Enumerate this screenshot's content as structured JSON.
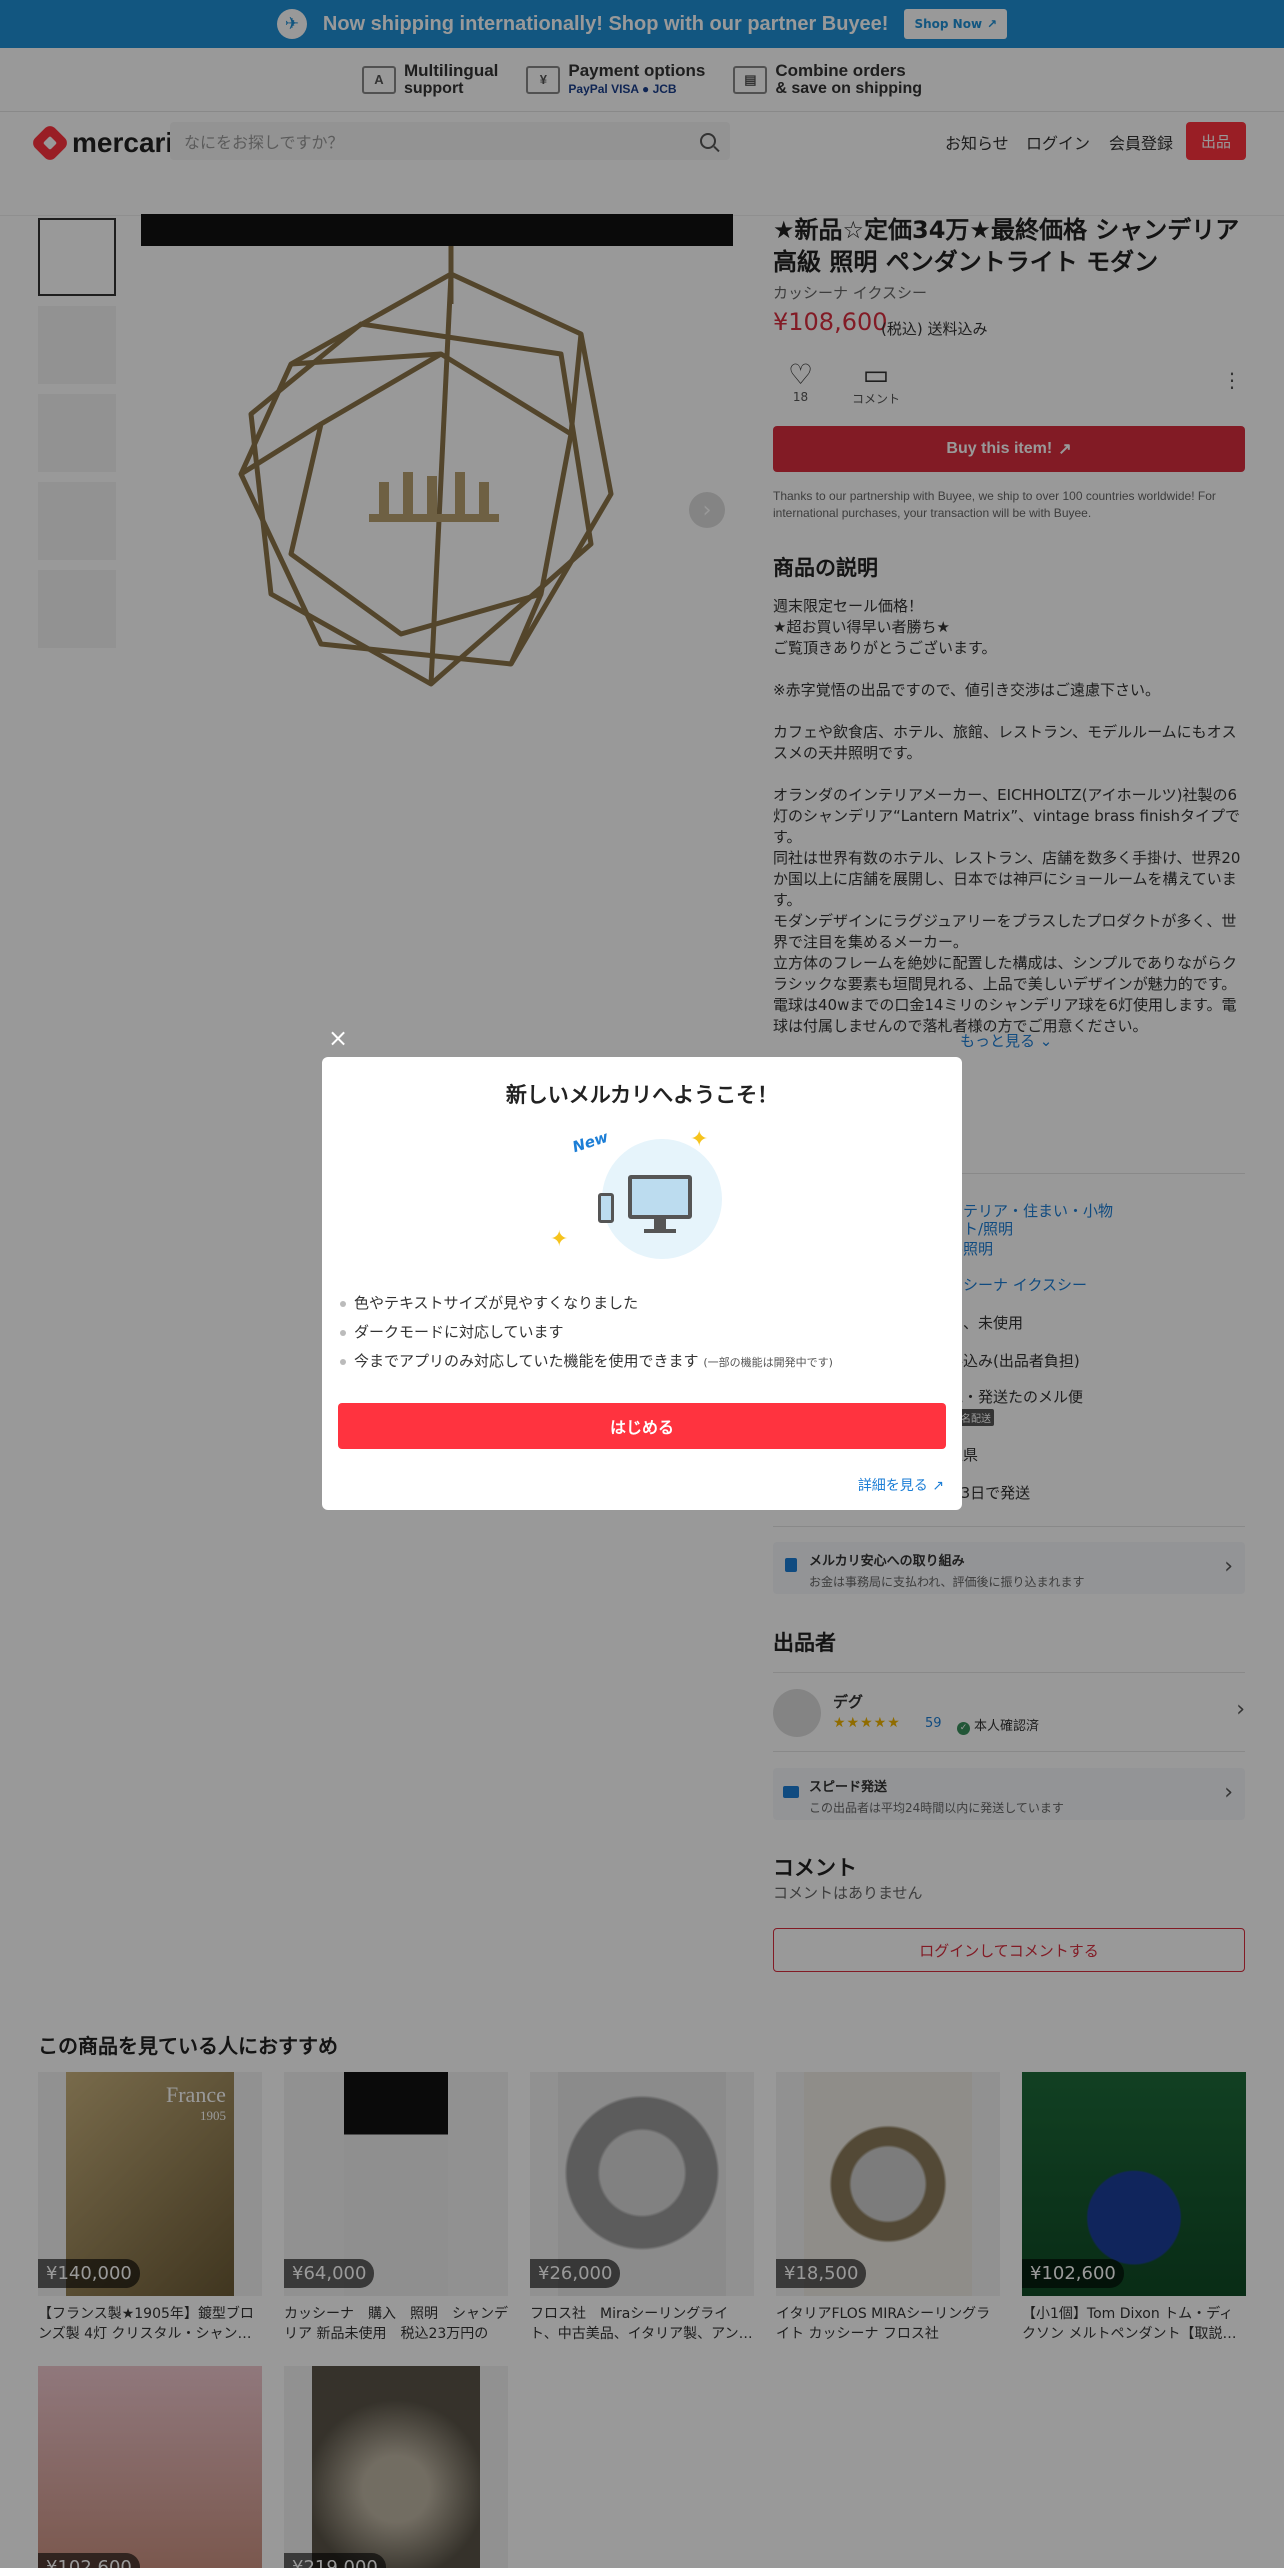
{
  "banner": {
    "text": "Now shipping internationally! Shop with our partner Buyee!",
    "button": "Shop Now"
  },
  "features": [
    {
      "icon": "A",
      "line1": "Multilingual",
      "line2": "support"
    },
    {
      "icon": "¥",
      "line1": "Payment options",
      "line2": "PayPal VISA ● JCB"
    },
    {
      "icon": "▤",
      "line1": "Combine orders",
      "line2": "& save on shipping"
    }
  ],
  "header": {
    "logo": "mercari",
    "search_placeholder": "なにをお探しですか？",
    "nav": {
      "notice": "お知らせ",
      "login": "ログイン",
      "signup": "会員登録",
      "sell": "出品"
    }
  },
  "item": {
    "title": "★新品☆定価34万★最終価格 シャンデリア 高級 照明 ペンダントライト モダン",
    "brand": "カッシーナ イクスシー",
    "price": "¥108,600",
    "price_note": "(税込) 送料込み",
    "likes": "18",
    "comment_label": "コメント",
    "buy_button": "Buy this item!",
    "buy_note": "Thanks to our partnership with Buyee, we ship to over 100 countries worldwide! For international purchases, your transaction will be with Buyee.",
    "desc_title": "商品の説明",
    "description": "週末限定セール価格！\n★超お買い得早い者勝ち★\nご覧頂きありがとうございます。\n\n※赤字覚悟の出品ですので、値引き交渉はご遠慮下さい。\n\nカフェや飲食店、ホテル、旅館、レストラン、モデルルームにもオススメの天井照明です。\n\nオランダのインテリアメーカー、EICHHOLTZ(アイホールツ)社製の6灯のシャンデリア“Lantern Matrix”、vintage brass finishタイプです。\n同社は世界有数のホテル、レストラン、店舗を数多く手掛け、世界20か国以上に店舗を展開し、日本では神戸にショールームを構えています。\nモダンデザインにラグジュアリーをプラスしたプロダクトが多く、世界で注目を集めるメーカー。\n立方体のフレームを絶妙に配置した構成は、シンプルでありながらクラシックな要素も垣間見れる、上品で美しいデザインが魅力的です。\n電球は40wまでの口金14ミリのシャンデリア球を6灯使用します。電球は付属しませんので落札者様の方でご用意ください。",
    "see_more": "もっと見る"
  },
  "details": {
    "category_1": "ンテリア・住まい・小物",
    "category_2": "イト/照明",
    "category_3": "井照明",
    "brand": "ッシーナ イクスシー",
    "condition": "品、未使用",
    "shipping_fee": "料込み(出品者負担)",
    "shipping_method": "包・発送たのメル便",
    "shipping_tag": "匿名配送",
    "origin": "玉県",
    "days": "~3日で発送"
  },
  "anshin": {
    "title": "メルカリ安心への取り組み",
    "sub": "お金は事務局に支払われ、評価後に振り込まれます"
  },
  "seller": {
    "section": "出品者",
    "name": "デグ",
    "stars": "★★★★★",
    "count": "59",
    "verified": "本人確認済"
  },
  "speed": {
    "title": "スピード発送",
    "sub": "この出品者は平均24時間以内に発送しています"
  },
  "comments": {
    "section": "コメント",
    "none": "コメントはありません",
    "login_button": "ログインしてコメントする"
  },
  "recommend": {
    "title": "この商品を見ている人におすすめ",
    "items": [
      {
        "price": "¥140,000",
        "name": "【フランス製★1905年】鍍型ブロンズ製 4灯 クリスタル・シャンデリア",
        "caption": "France",
        "caption2": "1905"
      },
      {
        "price": "¥64,000",
        "name": "カッシーナ　購入　照明　シャンデリア 新品未使用　税込23万円の"
      },
      {
        "price": "¥26,000",
        "name": "フロス社　Miraシーリングライト、中古美品、イタリア製、アンティーク"
      },
      {
        "price": "¥18,500",
        "name": "イタリアFLOS MIRAシーリングライト カッシーナ フロス社"
      },
      {
        "price": "¥102,600",
        "name": "【小1個】Tom Dixon トム・ディクソン メルトペンダント【取説あり】"
      },
      {
        "price": "¥102,600",
        "name": ""
      },
      {
        "price": "¥219,000",
        "name": ""
      }
    ]
  },
  "modal": {
    "title": "新しいメルカリへようこそ！",
    "badge": "New",
    "bullets": [
      "色やテキストサイズが見やすくなりました",
      "ダークモードに対応しています",
      "今までアプリのみ対応していた機能を使用できます"
    ],
    "bullet3_note": "(一部の機能は開発中です)",
    "start_button": "はじめる",
    "details_link": "詳細を見る"
  }
}
